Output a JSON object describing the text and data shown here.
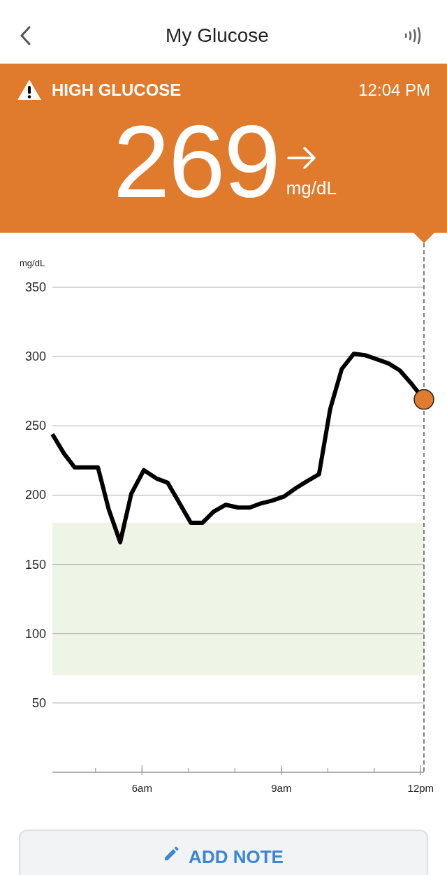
{
  "header": {
    "title": "My Glucose"
  },
  "alert": {
    "label": "HIGH GLUCOSE",
    "time": "12:04 PM",
    "value": "269",
    "unit": "mg/dL"
  },
  "chart": {
    "chart_data": {
      "type": "line",
      "ylabel": "mg/dL",
      "grid": true,
      "bands": [
        {
          "axis": "y",
          "from": 70,
          "to": 180,
          "color": "#eef5e6"
        }
      ],
      "xlim": [
        4.07,
        12.07
      ],
      "ylim": [
        0,
        350
      ],
      "yticks": [
        50,
        100,
        150,
        200,
        250,
        300,
        350
      ],
      "xticks": [
        {
          "value": 6,
          "label": "6am"
        },
        {
          "value": 9,
          "label": "9am"
        },
        {
          "value": 12,
          "label": "12pm"
        }
      ],
      "x": [
        4.07,
        4.32,
        4.55,
        5.05,
        5.28,
        5.53,
        5.77,
        6.04,
        6.31,
        6.55,
        6.81,
        7.05,
        7.3,
        7.54,
        7.8,
        8.07,
        8.32,
        8.56,
        8.8,
        9.06,
        9.31,
        9.55,
        9.81,
        10.05,
        10.3,
        10.56,
        10.8,
        11.06,
        11.31,
        11.55,
        11.81,
        12.07
      ],
      "series": [
        {
          "color": "#000000",
          "values": [
            244,
            230,
            220,
            220,
            190,
            166,
            201,
            218,
            212,
            209,
            194,
            180,
            180,
            188,
            193,
            191,
            191,
            194,
            196,
            199,
            205,
            210,
            215,
            262,
            291,
            302,
            301,
            298,
            295,
            290,
            280,
            269
          ]
        }
      ]
    }
  },
  "button": {
    "label": "ADD NOTE"
  }
}
